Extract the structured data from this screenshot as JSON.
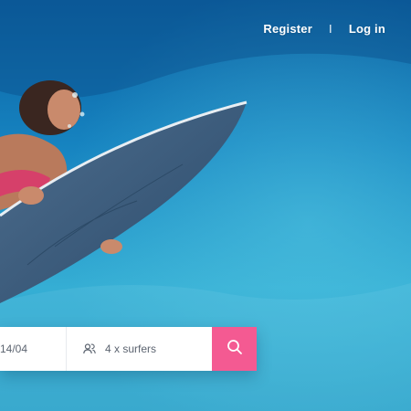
{
  "header": {
    "register_label": "Register",
    "separator": "I",
    "login_label": "Log in"
  },
  "search": {
    "dates_value": "14/04",
    "surfers_value": "4 x surfers"
  },
  "icons": {
    "surfers_icon": "people-icon",
    "search_icon": "search-icon"
  },
  "colors": {
    "accent": "#f45a92",
    "water_light": "#38b0d6",
    "water_dark": "#0b5fa0",
    "field_bg": "#ffffff"
  }
}
